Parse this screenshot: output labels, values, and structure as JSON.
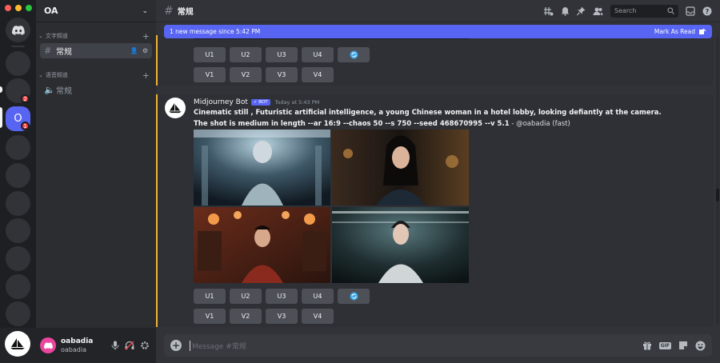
{
  "server": {
    "name": "OA",
    "active_initial": "O"
  },
  "rail": {
    "badge_dm": "2",
    "badge_active": "1"
  },
  "sidebar": {
    "text_category": "文字頻道",
    "voice_category": "语音頻道",
    "text_channel": "常规",
    "voice_channel": "常规"
  },
  "user": {
    "display_name": "oabadia",
    "username": "oabadia"
  },
  "header": {
    "channel": "常规",
    "search_placeholder": "Search"
  },
  "new_messages": {
    "text": "1 new message since 5:42 PM",
    "action": "Mark As Read"
  },
  "message": {
    "author": "Midjourney Bot",
    "bot_tag": "BOT",
    "timestamp": "Today at 5:43 PM",
    "prompt": "Cinematic still , Futuristic artificial intelligence, a young Chinese woman in a hotel lobby, looking defiantly at the camera. The shot is medium in length --ar 16:9 --chaos 50 --s 750 --seed 468670995 --v 5.1",
    "suffix": " - @oabadia (fast)"
  },
  "buttons": {
    "upscale": [
      "U1",
      "U2",
      "U3",
      "U4"
    ],
    "variation": [
      "V1",
      "V2",
      "V3",
      "V4"
    ]
  },
  "composer": {
    "placeholder": "Message #常规"
  },
  "icons": [
    "threads-icon",
    "bell-icon",
    "pin-icon",
    "members-icon",
    "search-icon",
    "inbox-icon",
    "help-icon",
    "refresh-icon",
    "gift-icon",
    "gif-icon",
    "sticker-icon",
    "emoji-icon",
    "mic-icon",
    "headphones-icon",
    "gear-icon"
  ],
  "colors": {
    "accent": "#5865f2",
    "highlight_bar": "#f0b232",
    "danger": "#f23f43"
  }
}
